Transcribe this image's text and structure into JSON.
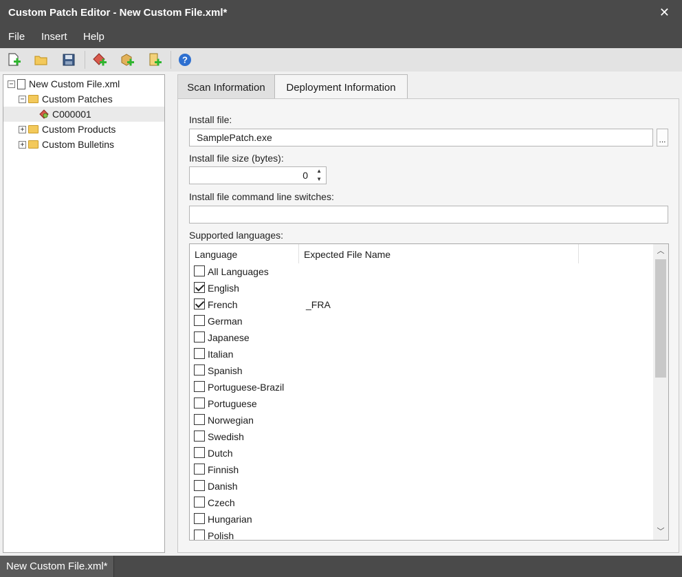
{
  "window": {
    "title": "Custom Patch Editor - New Custom File.xml*",
    "close_glyph": "✕"
  },
  "menu": [
    "File",
    "Insert",
    "Help"
  ],
  "toolbar": {
    "icons": [
      "new-file-icon",
      "open-folder-icon",
      "save-icon",
      "add-patch-icon",
      "add-product-icon",
      "add-bulletin-icon",
      "help-icon"
    ],
    "help_glyph": "?"
  },
  "tree": {
    "root": "New Custom File.xml",
    "custom_patches": "Custom Patches",
    "patch_item": "C000001",
    "custom_products": "Custom Products",
    "custom_bulletins": "Custom Bulletins",
    "collapse_glyph": "−",
    "expand_glyph": "+"
  },
  "tabs": {
    "scan": "Scan Information",
    "deployment": "Deployment Information"
  },
  "form": {
    "install_file_label": "Install file:",
    "install_file_value": "SamplePatch.exe",
    "browse_label": "...",
    "size_label": "Install file size (bytes):",
    "size_value": "0",
    "switches_label": "Install file command line switches:",
    "switches_value": "",
    "languages_label": "Supported languages:"
  },
  "languages": {
    "col_language": "Language",
    "col_filename": "Expected File Name",
    "rows": [
      {
        "name": "All Languages",
        "checked": false,
        "file": ""
      },
      {
        "name": "English",
        "checked": true,
        "file": ""
      },
      {
        "name": "French",
        "checked": true,
        "file": "_FRA"
      },
      {
        "name": "German",
        "checked": false,
        "file": ""
      },
      {
        "name": "Japanese",
        "checked": false,
        "file": ""
      },
      {
        "name": "Italian",
        "checked": false,
        "file": ""
      },
      {
        "name": "Spanish",
        "checked": false,
        "file": ""
      },
      {
        "name": "Portuguese-Brazil",
        "checked": false,
        "file": ""
      },
      {
        "name": "Portuguese",
        "checked": false,
        "file": ""
      },
      {
        "name": "Norwegian",
        "checked": false,
        "file": ""
      },
      {
        "name": "Swedish",
        "checked": false,
        "file": ""
      },
      {
        "name": "Dutch",
        "checked": false,
        "file": ""
      },
      {
        "name": "Finnish",
        "checked": false,
        "file": ""
      },
      {
        "name": "Danish",
        "checked": false,
        "file": ""
      },
      {
        "name": "Czech",
        "checked": false,
        "file": ""
      },
      {
        "name": "Hungarian",
        "checked": false,
        "file": ""
      },
      {
        "name": "Polish",
        "checked": false,
        "file": ""
      }
    ]
  },
  "status": {
    "tab": "New Custom File.xml*"
  },
  "colors": {
    "chrome": "#4a4a4a",
    "folder": "#f3c95b",
    "add_green": "#2fb52f",
    "help_blue": "#2d6fd0"
  }
}
